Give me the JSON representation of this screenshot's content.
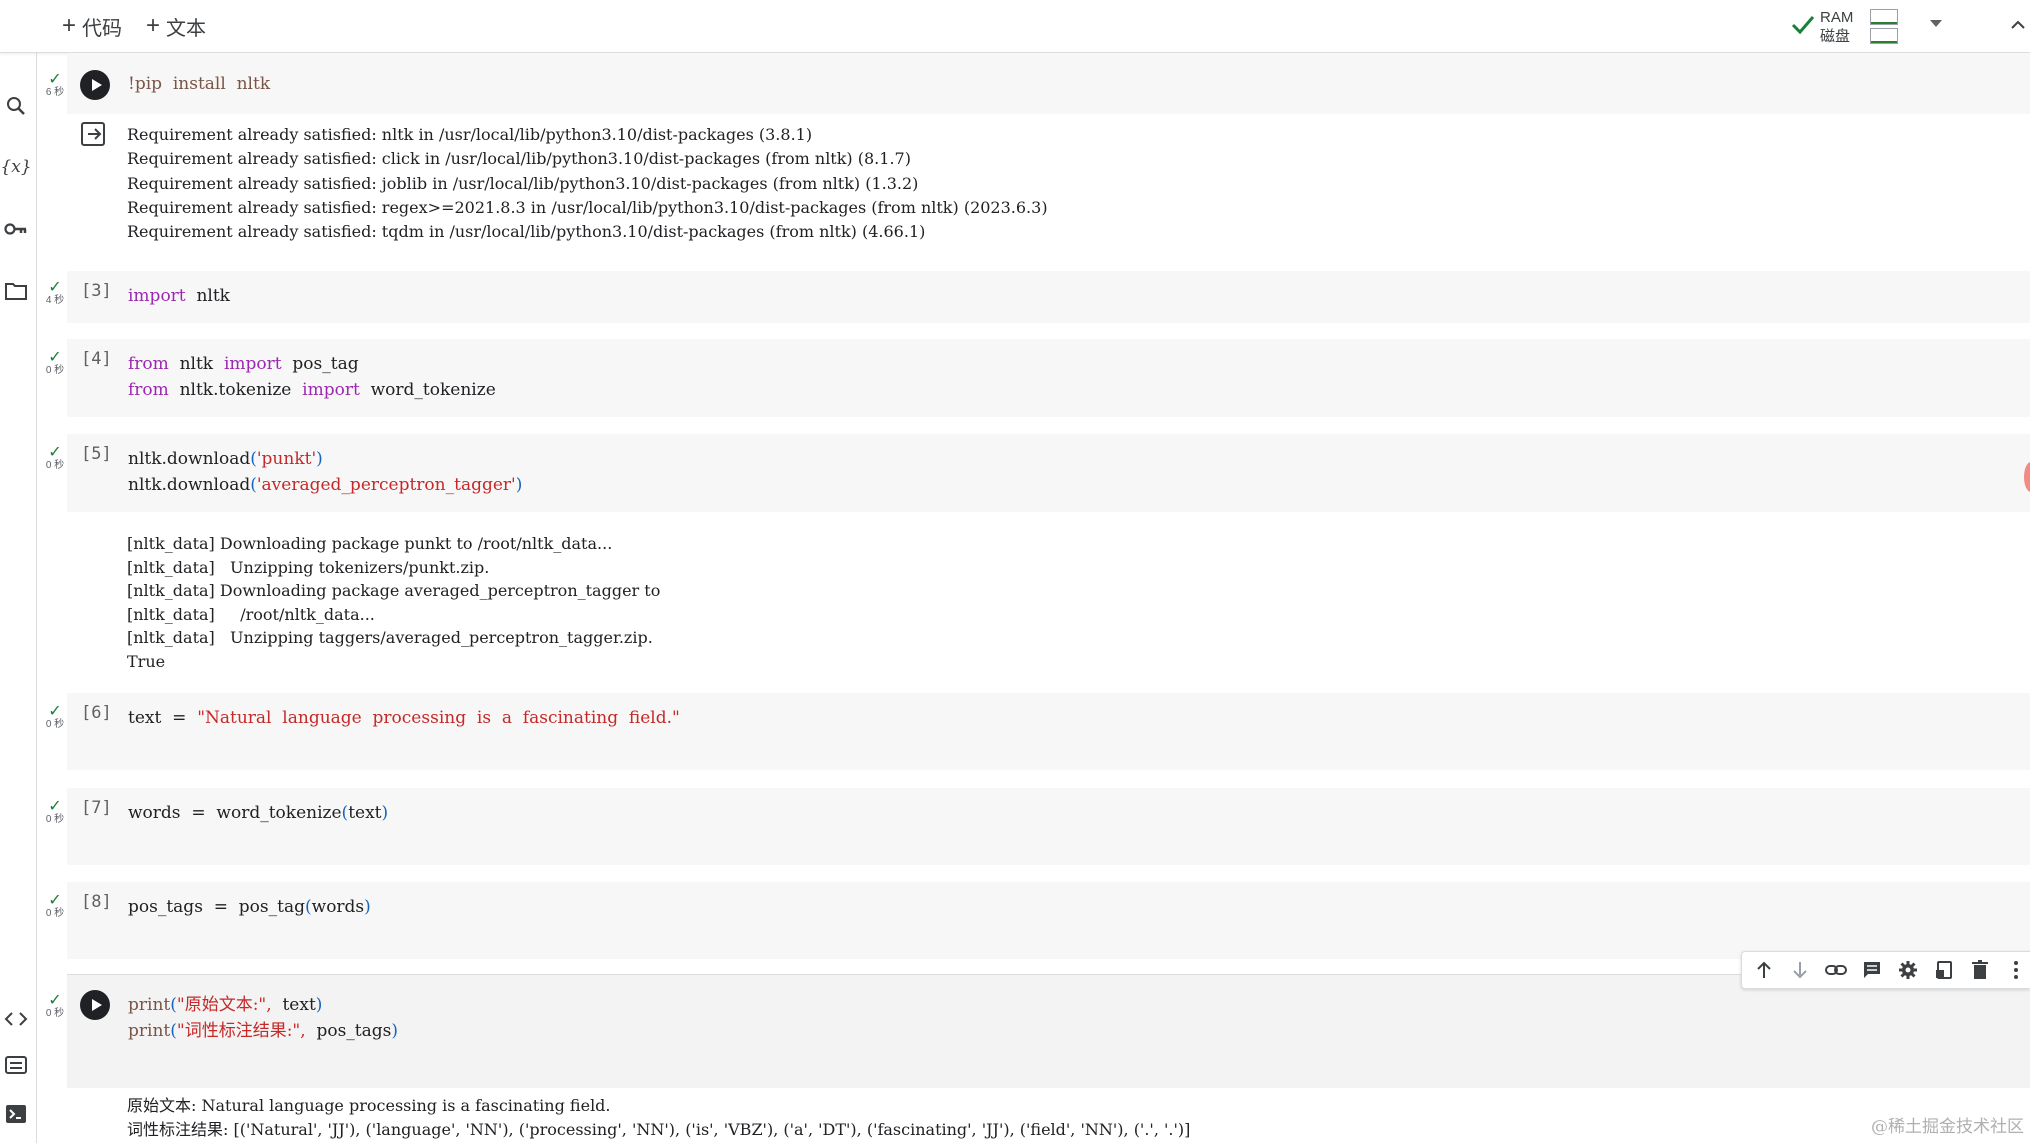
{
  "toolbar": {
    "add_code": "代码",
    "add_text": "文本",
    "ram_label": "RAM",
    "disk_label": "磁盘"
  },
  "cells": [
    {
      "status": "6 秒",
      "code": "!pip  install  nltk",
      "output": "Requirement already satisfied: nltk in /usr/local/lib/python3.10/dist-packages (3.8.1)\nRequirement already satisfied: click in /usr/local/lib/python3.10/dist-packages (from nltk) (8.1.7)\nRequirement already satisfied: joblib in /usr/local/lib/python3.10/dist-packages (from nltk) (1.3.2)\nRequirement already satisfied: regex>=2021.8.3 in /usr/local/lib/python3.10/dist-packages (from nltk) (2023.6.3)\nRequirement already satisfied: tqdm in /usr/local/lib/python3.10/dist-packages (from nltk) (4.66.1)"
    },
    {
      "status": "4 秒",
      "count": "[3]"
    },
    {
      "status": "0 秒",
      "count": "[4]"
    },
    {
      "status": "0 秒",
      "count": "[5]",
      "output": "[nltk_data] Downloading package punkt to /root/nltk_data...\n[nltk_data]   Unzipping tokenizers/punkt.zip.\n[nltk_data] Downloading package averaged_perceptron_tagger to\n[nltk_data]     /root/nltk_data...\n[nltk_data]   Unzipping taggers/averaged_perceptron_tagger.zip.\nTrue"
    },
    {
      "status": "0 秒",
      "count": "[6]"
    },
    {
      "status": "0 秒",
      "count": "[7]"
    },
    {
      "status": "0 秒",
      "count": "[8]"
    },
    {
      "status": "0 秒",
      "output": "原始文本: Natural language processing is a fascinating field.\n词性标注结果: [('Natural', 'JJ'), ('language', 'NN'), ('processing', 'NN'), ('is', 'VBZ'), ('a', 'DT'), ('fascinating', 'JJ'), ('field', 'NN'), ('.', '.')]"
    }
  ],
  "code_tokens": {
    "c3_kw": "import",
    "c3_mod": "nltk",
    "c4_l1_from": "from",
    "c4_l1_mod": "nltk",
    "c4_l1_imp": "import",
    "c4_l1_name": "pos_tag",
    "c4_l2_from": "from",
    "c4_l2_mod": "nltk.tokenize",
    "c4_l2_imp": "import",
    "c4_l2_name": "word_tokenize",
    "c5_l1_fn": "nltk.download",
    "c5_l1_arg": "'punkt'",
    "c5_l2_fn": "nltk.download",
    "c5_l2_arg": "'averaged_perceptron_tagger'",
    "c6_var": "text",
    "c6_eq": "=",
    "c6_str": "\"Natural  language  processing  is  a  fascinating  field.\"",
    "c7_var": "words",
    "c7_eq": "=",
    "c7_fn": "word_tokenize",
    "c7_arg": "text",
    "c8_var": "pos_tags",
    "c8_eq": "=",
    "c8_fn": "pos_tag",
    "c8_arg": "words",
    "c9_l1_fn": "print",
    "c9_l1_str": "\"原始文本:\",",
    "c9_l1_arg": "text",
    "c9_l2_fn": "print",
    "c9_l2_str": "\"词性标注结果:\",",
    "c9_l2_arg": "pos_tags"
  },
  "icons": {
    "rail": [
      "toc-icon",
      "search-icon",
      "variables-icon",
      "key-icon",
      "folder-icon",
      "code-snippets-icon",
      "command-palette-icon",
      "terminal-icon"
    ],
    "cell_toolbar": [
      "arrow-up-icon",
      "arrow-down-icon",
      "link-icon",
      "comment-icon",
      "gear-icon",
      "mirror-cell-icon",
      "trash-icon",
      "more-icon"
    ]
  },
  "colors": {
    "keyword": "#9c27b0",
    "string": "#c62828",
    "ok": "#188038",
    "cell_bg": "#f7f7f7"
  },
  "resources": {
    "ram_usage": 0.1,
    "disk_usage": 0.1
  },
  "watermark": "@稀土掘金技术社区"
}
